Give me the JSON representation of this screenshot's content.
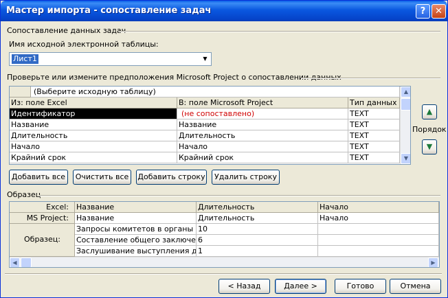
{
  "window": {
    "title": "Мастер импорта - сопоставление задач",
    "help_label": "?",
    "close_label": "✕"
  },
  "mapping": {
    "group_label": "Сопоставление данных задач",
    "source_label": "Имя исходной электронной таблицы:",
    "source_value": "Лист1",
    "verify_label": "Проверьте или измените предположения Microsoft Project о сопоставлении данных",
    "select_placeholder": "(Выберите исходную таблицу)",
    "columns": [
      "Из: поле Excel",
      "В:  поле Microsoft Project",
      "Тип данных"
    ],
    "rows": [
      [
        "Идентификатор",
        "(не сопоставлено)",
        "TEXT"
      ],
      [
        "Название",
        "Название",
        "TEXT"
      ],
      [
        "Длительность",
        "Длительность",
        "TEXT"
      ],
      [
        "Начало",
        "Начало",
        "TEXT"
      ],
      [
        "Крайний срок",
        "Крайний срок",
        "TEXT"
      ]
    ],
    "order_label": "Порядок",
    "buttons": [
      "Добавить все",
      "Очистить все",
      "Добавить строку",
      "Удалить строку"
    ]
  },
  "sample": {
    "group_label": "Образец",
    "row_labels": [
      "Excel:",
      "MS Project:",
      "Образец:"
    ],
    "excel_row": [
      "Название",
      "Длительность",
      "Начало"
    ],
    "project_row": [
      "Название",
      "Длительность",
      "Начало"
    ],
    "data_rows": [
      [
        "Запросы комитетов в органы испо",
        "10",
        ""
      ],
      [
        "Составление общего заключения",
        "6",
        ""
      ],
      [
        "Заслушивание выступления долж",
        "1",
        ""
      ]
    ]
  },
  "footer": {
    "back": "< Назад",
    "next": "Далее >",
    "finish": "Готово",
    "cancel": "Отмена"
  },
  "colors": {
    "titlebar": "#0a58e0",
    "selection": "#316ac5",
    "unmapped": "#d00000"
  }
}
